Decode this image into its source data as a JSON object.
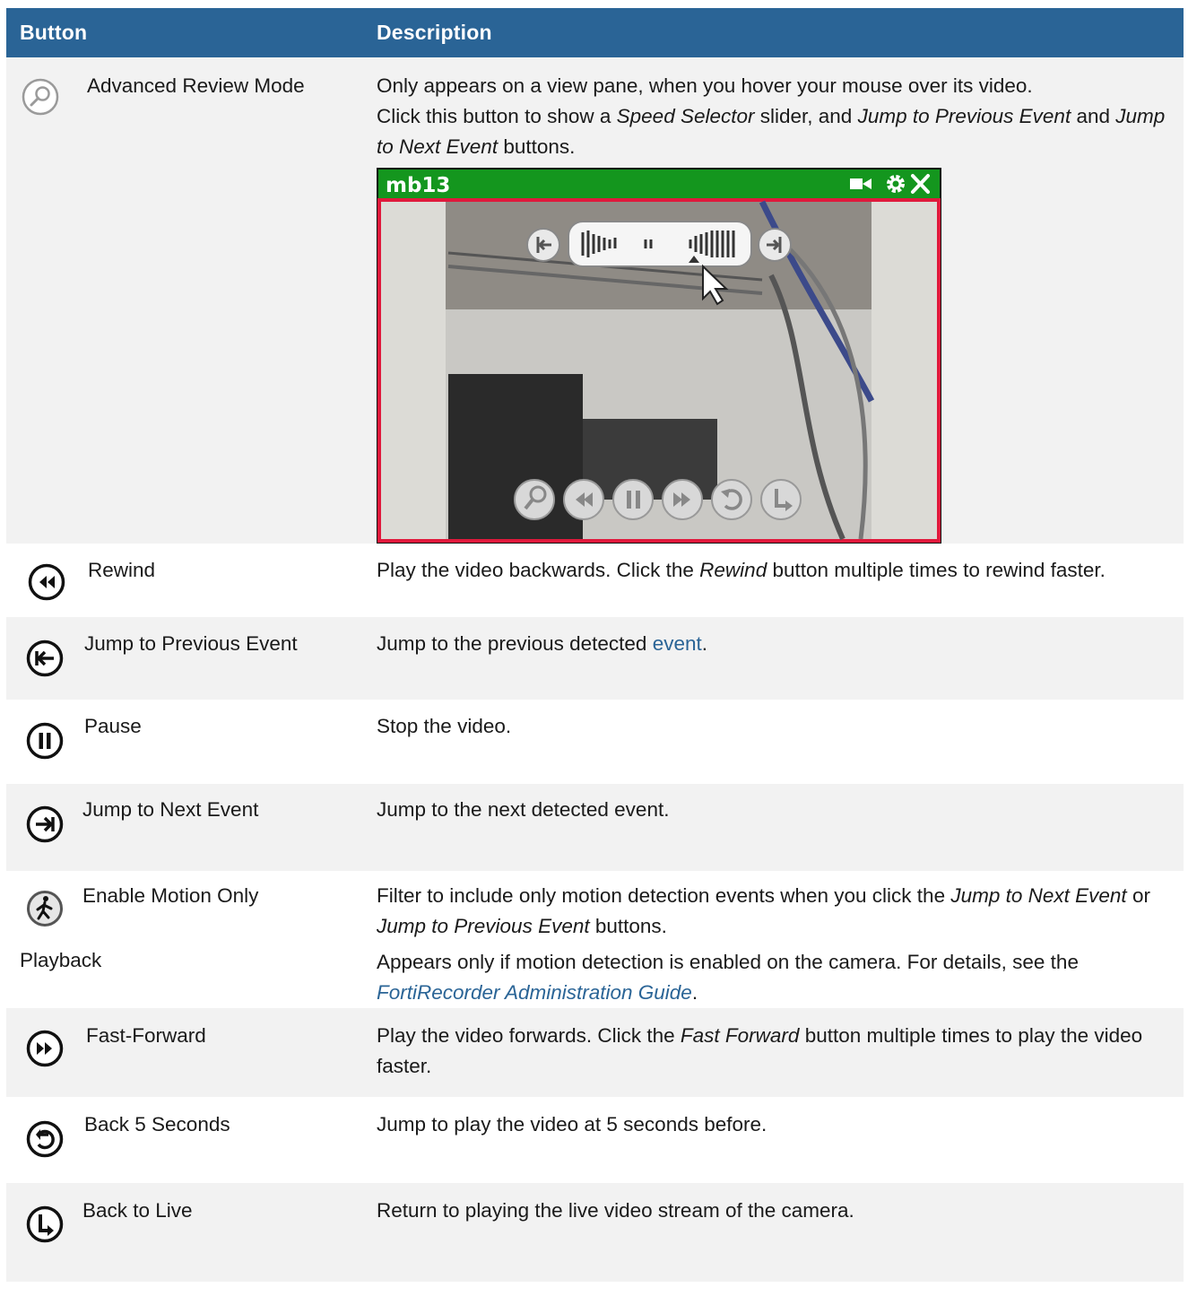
{
  "table": {
    "headers": {
      "button": "Button",
      "description": "Description"
    },
    "rows": [
      {
        "label": "Advanced Review Mode",
        "icon": "advanced-review-icon",
        "desc": {
          "p1": "Only appears on a view pane, when you hover your mouse over its video.",
          "p2_a": "Click this button to show a ",
          "p2_em1": "Speed Selector",
          "p2_b": " slider, and ",
          "p2_em2": "Jump to Previous Event",
          "p2_c": " and ",
          "p2_em3": "Jump to Next Event",
          "p2_d": " buttons."
        },
        "screenshot": {
          "camera_name": "mb13"
        }
      },
      {
        "label": "Rewind",
        "icon": "rewind-icon",
        "desc": {
          "a": "Play the video backwards. Click the ",
          "em": "Rewind",
          "b": " button multiple times to rewind faster."
        }
      },
      {
        "label": "Jump to Previous Event",
        "icon": "jump-previous-icon",
        "desc": {
          "a": "Jump to the previous detected ",
          "link": "event",
          "b": "."
        }
      },
      {
        "label": "Pause",
        "icon": "pause-icon",
        "desc": {
          "a": "Stop the video."
        }
      },
      {
        "label": "Jump to Next Event",
        "icon": "jump-next-icon",
        "desc": {
          "a": "Jump to the next detected event."
        }
      },
      {
        "label": "Enable Motion Only",
        "label_cont": "Playback",
        "icon": "motion-only-icon",
        "desc": {
          "p1_a": "Filter to include only motion detection events when you click the ",
          "p1_em1": "Jump to Next Event",
          "p1_b": " or ",
          "p1_em2": "Jump to Previous Event",
          "p1_c": " buttons.",
          "p2_a": "Appears only if motion detection is enabled on the camera. For details, see the ",
          "p2_link": "FortiRecorder Administration Guide",
          "p2_b": "."
        }
      },
      {
        "label": "Fast-Forward",
        "icon": "fast-forward-icon",
        "desc": {
          "a": "Play the video forwards. Click the ",
          "em": "Fast Forward",
          "b": " button multiple times to play the video faster."
        }
      },
      {
        "label": "Back 5 Seconds",
        "icon": "back-5-seconds-icon",
        "desc": {
          "a": "Jump to play the video at 5 seconds before."
        }
      },
      {
        "label": "Back to Live",
        "icon": "back-to-live-icon",
        "desc": {
          "a": "Return to playing the live video stream of the camera."
        }
      }
    ]
  }
}
